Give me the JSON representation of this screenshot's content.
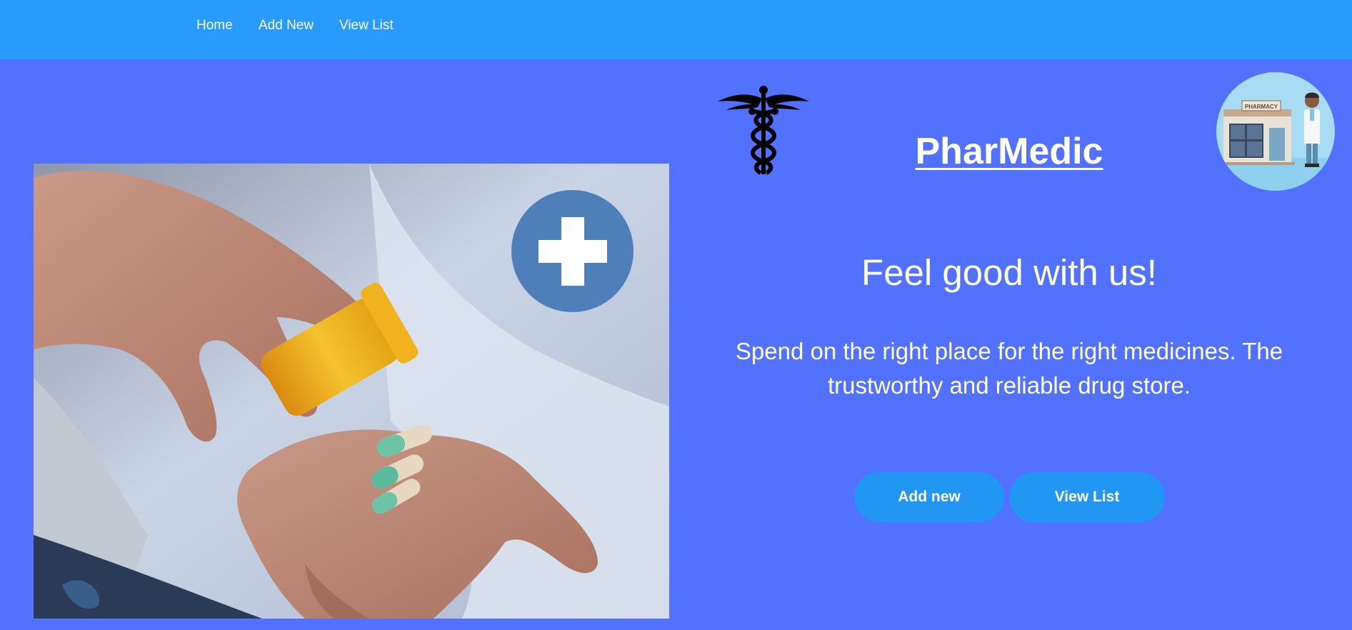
{
  "nav": {
    "items": [
      {
        "label": "Home"
      },
      {
        "label": "Add New"
      },
      {
        "label": "View List"
      }
    ]
  },
  "brand": {
    "title": "PharMedic",
    "logo_icon": "caduceus-icon"
  },
  "hero": {
    "tagline": "Feel good with us!",
    "description": "Spend on the right place for the right medicines. The trustworthy and reliable drug store.",
    "image_icon": "medical-cross-icon",
    "badge_sign": "PHARMACY"
  },
  "actions": {
    "add_label": "Add new",
    "view_label": "View List"
  },
  "colors": {
    "page_background": "#5271ff",
    "navbar_background": "#299bff",
    "button_background": "#2196f3",
    "text": "#ffffff"
  }
}
